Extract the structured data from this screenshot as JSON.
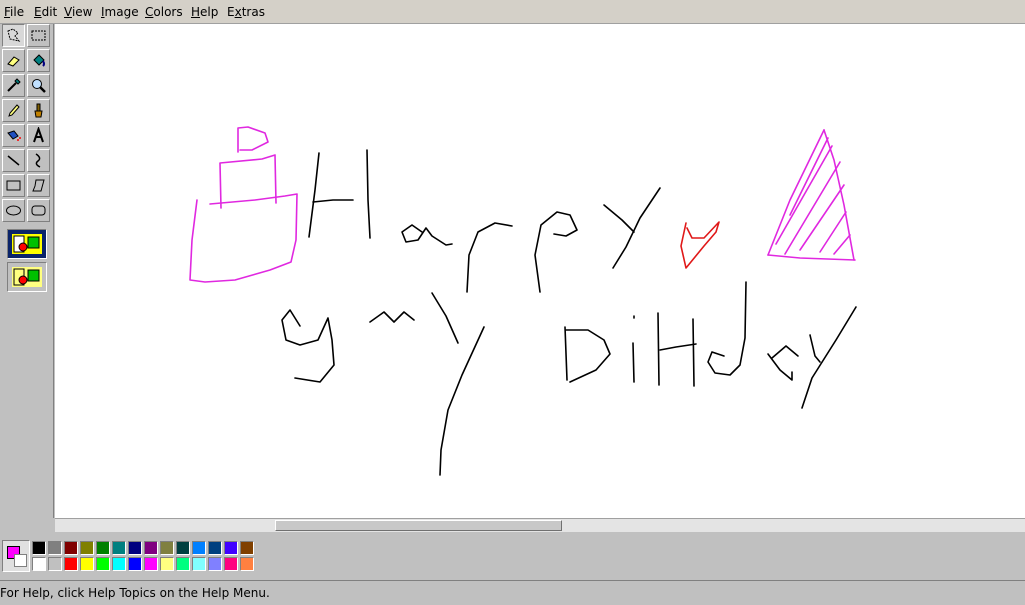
{
  "menu": {
    "items": [
      {
        "pre": "",
        "key": "F",
        "post": "ile"
      },
      {
        "pre": "",
        "key": "E",
        "post": "dit"
      },
      {
        "pre": "",
        "key": "V",
        "post": "iew"
      },
      {
        "pre": "",
        "key": "I",
        "post": "mage"
      },
      {
        "pre": "",
        "key": "C",
        "post": "olors"
      },
      {
        "pre": "",
        "key": "H",
        "post": "elp"
      },
      {
        "pre": "E",
        "key": "x",
        "post": "tras"
      }
    ]
  },
  "tools": [
    {
      "name": "free-form-select-icon"
    },
    {
      "name": "rect-select-icon"
    },
    {
      "name": "eraser-icon"
    },
    {
      "name": "fill-bucket-icon"
    },
    {
      "name": "color-picker-icon"
    },
    {
      "name": "magnifier-icon"
    },
    {
      "name": "pencil-icon"
    },
    {
      "name": "brush-icon"
    },
    {
      "name": "airbrush-icon"
    },
    {
      "name": "text-icon"
    },
    {
      "name": "line-icon"
    },
    {
      "name": "curve-icon"
    },
    {
      "name": "rectangle-icon"
    },
    {
      "name": "polygon-icon"
    },
    {
      "name": "ellipse-icon"
    },
    {
      "name": "rounded-rectangle-icon"
    }
  ],
  "palette": {
    "foreground": "#ff00ff",
    "background": "#ffffff",
    "colors_top": [
      "#000000",
      "#808080",
      "#800000",
      "#808000",
      "#008000",
      "#008080",
      "#000080",
      "#800080",
      "#808040",
      "#004040",
      "#0080ff",
      "#004080",
      "#4000ff",
      "#804000"
    ],
    "colors_bottom": [
      "#ffffff",
      "#c0c0c0",
      "#ff0000",
      "#ffff00",
      "#00ff00",
      "#00ffff",
      "#0000ff",
      "#ff00ff",
      "#ffff80",
      "#00ff80",
      "#80ffff",
      "#8080ff",
      "#ff0080",
      "#ff8040"
    ]
  },
  "canvas": {
    "background": "#ffffff",
    "stroke_colors": {
      "text": "#000000",
      "cake": "#e028e0",
      "heart": "#e01818",
      "hat": "#e028e0"
    }
  },
  "status": {
    "text": "For Help, click Help Topics on the Help Menu."
  }
}
